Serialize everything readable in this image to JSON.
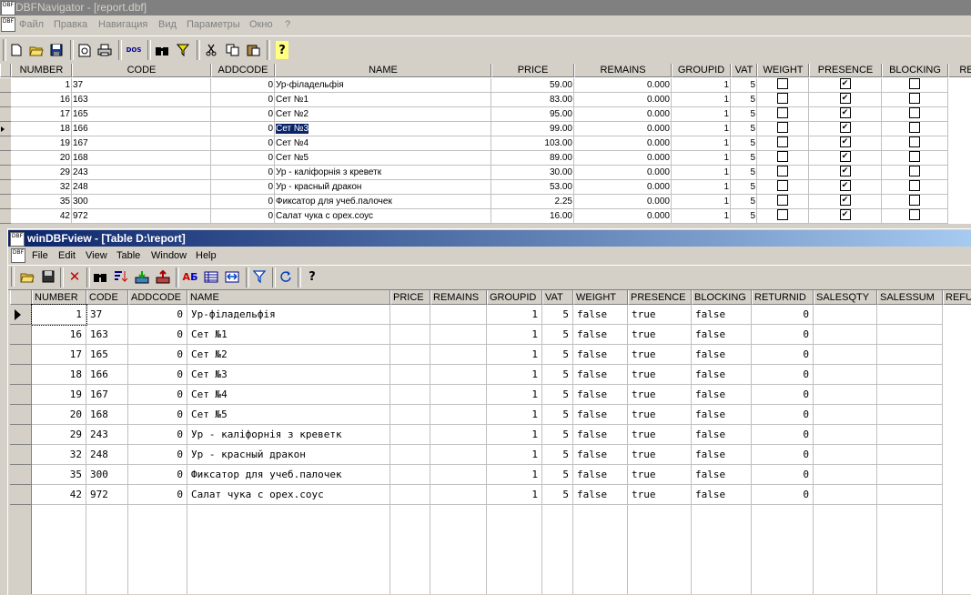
{
  "nav": {
    "title": "DBFNavigator - [report.dbf]",
    "icon_label": "DBF",
    "menu": [
      "Файл",
      "Правка",
      "Навигация",
      "Вид",
      "Параметры",
      "Окно",
      "?"
    ],
    "toolbar": [
      "new-icon",
      "open-icon",
      "save-icon",
      "preview-icon",
      "print-icon",
      "dos-icon",
      "find-icon",
      "filter-icon",
      "cut-icon",
      "copy-icon",
      "paste-icon",
      "help-icon"
    ],
    "dos_label": "DOS",
    "columns": [
      "NUMBER",
      "CODE",
      "ADDCODE",
      "NAME",
      "PRICE",
      "REMAINS",
      "GROUPID",
      "VAT",
      "WEIGHT",
      "PRESENCE",
      "BLOCKING",
      "RE"
    ],
    "rows": [
      {
        "number": "1",
        "code": "37",
        "addcode": "0",
        "name": "Ур-філадельфія",
        "price": "59.00",
        "remains": "0.000",
        "groupid": "1",
        "vat": "5",
        "weight": false,
        "presence": true,
        "blocking": false
      },
      {
        "number": "16",
        "code": "163",
        "addcode": "0",
        "name": "Сет №1",
        "price": "83.00",
        "remains": "0.000",
        "groupid": "1",
        "vat": "5",
        "weight": false,
        "presence": true,
        "blocking": false
      },
      {
        "number": "17",
        "code": "165",
        "addcode": "0",
        "name": "Сет №2",
        "price": "95.00",
        "remains": "0.000",
        "groupid": "1",
        "vat": "5",
        "weight": false,
        "presence": true,
        "blocking": false
      },
      {
        "number": "18",
        "code": "166",
        "addcode": "0",
        "name": "Сет №3",
        "price": "99.00",
        "remains": "0.000",
        "groupid": "1",
        "vat": "5",
        "weight": false,
        "presence": true,
        "blocking": false
      },
      {
        "number": "19",
        "code": "167",
        "addcode": "0",
        "name": "Сет №4",
        "price": "103.00",
        "remains": "0.000",
        "groupid": "1",
        "vat": "5",
        "weight": false,
        "presence": true,
        "blocking": false
      },
      {
        "number": "20",
        "code": "168",
        "addcode": "0",
        "name": "Сет №5",
        "price": "89.00",
        "remains": "0.000",
        "groupid": "1",
        "vat": "5",
        "weight": false,
        "presence": true,
        "blocking": false
      },
      {
        "number": "29",
        "code": "243",
        "addcode": "0",
        "name": "Ур - каліфорнія з креветк",
        "price": "30.00",
        "remains": "0.000",
        "groupid": "1",
        "vat": "5",
        "weight": false,
        "presence": true,
        "blocking": false
      },
      {
        "number": "32",
        "code": "248",
        "addcode": "0",
        "name": "Ур - красный дракон",
        "price": "53.00",
        "remains": "0.000",
        "groupid": "1",
        "vat": "5",
        "weight": false,
        "presence": true,
        "blocking": false
      },
      {
        "number": "35",
        "code": "300",
        "addcode": "0",
        "name": "Фиксатор для учеб.палочек",
        "price": "2.25",
        "remains": "0.000",
        "groupid": "1",
        "vat": "5",
        "weight": false,
        "presence": true,
        "blocking": false
      },
      {
        "number": "42",
        "code": "972",
        "addcode": "0",
        "name": "Салат чука с орех.соус",
        "price": "16.00",
        "remains": "0.000",
        "groupid": "1",
        "vat": "5",
        "weight": false,
        "presence": true,
        "blocking": false
      }
    ],
    "selected_row": 3
  },
  "view": {
    "title": "winDBFview - [Table D:\\report]",
    "menu": [
      "File",
      "Edit",
      "View",
      "Table",
      "Window",
      "Help"
    ],
    "toolbar": [
      "open-icon",
      "save-icon",
      "delete-icon",
      "find-icon",
      "sort-icon",
      "import-icon",
      "export-icon",
      "charset-icon",
      "struct-icon",
      "resize-icon",
      "filter-icon",
      "refresh-icon",
      "help-icon"
    ],
    "columns": [
      "NUMBER",
      "CODE",
      "ADDCODE",
      "NAME",
      "PRICE",
      "REMAINS",
      "GROUPID",
      "VAT",
      "WEIGHT",
      "PRESENCE",
      "BLOCKING",
      "RETURNID",
      "SALESQTY",
      "SALESSUM",
      "REFU"
    ],
    "rows": [
      [
        "1",
        "37",
        "0",
        "Ур-філадельфія",
        "",
        "",
        "1",
        "5",
        "false",
        "true",
        "false",
        "0",
        "",
        ""
      ],
      [
        "16",
        "163",
        "0",
        "Сет №1",
        "",
        "",
        "1",
        "5",
        "false",
        "true",
        "false",
        "0",
        "",
        ""
      ],
      [
        "17",
        "165",
        "0",
        "Сет №2",
        "",
        "",
        "1",
        "5",
        "false",
        "true",
        "false",
        "0",
        "",
        ""
      ],
      [
        "18",
        "166",
        "0",
        "Сет №3",
        "",
        "",
        "1",
        "5",
        "false",
        "true",
        "false",
        "0",
        "",
        ""
      ],
      [
        "19",
        "167",
        "0",
        "Сет №4",
        "",
        "",
        "1",
        "5",
        "false",
        "true",
        "false",
        "0",
        "",
        ""
      ],
      [
        "20",
        "168",
        "0",
        "Сет №5",
        "",
        "",
        "1",
        "5",
        "false",
        "true",
        "false",
        "0",
        "",
        ""
      ],
      [
        "29",
        "243",
        "0",
        "Ур - каліфорнія з креветк",
        "",
        "",
        "1",
        "5",
        "false",
        "true",
        "false",
        "0",
        "",
        ""
      ],
      [
        "32",
        "248",
        "0",
        "Ур - красный дракон",
        "",
        "",
        "1",
        "5",
        "false",
        "true",
        "false",
        "0",
        "",
        ""
      ],
      [
        "35",
        "300",
        "0",
        "Фиксатор для учеб.палочек",
        "",
        "",
        "1",
        "5",
        "false",
        "true",
        "false",
        "0",
        "",
        ""
      ],
      [
        "42",
        "972",
        "0",
        "Салат чука с орех.соус",
        "",
        "",
        "1",
        "5",
        "false",
        "true",
        "false",
        "0",
        "",
        ""
      ]
    ]
  },
  "colors": {
    "selection": "#0a246a",
    "face": "#d4d0c8"
  }
}
